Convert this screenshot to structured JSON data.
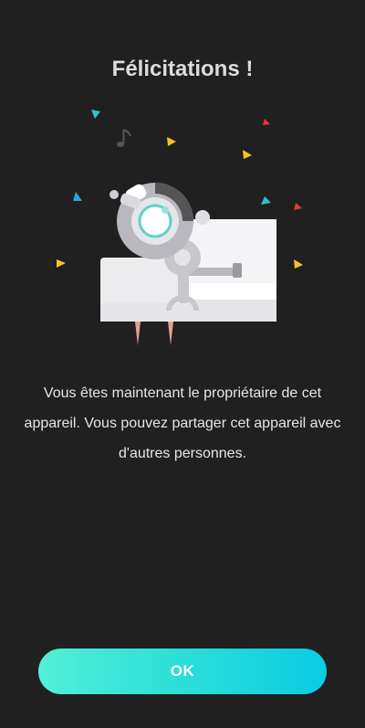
{
  "title": "Félicitations !",
  "message": "Vous êtes maintenant le propriétaire de cet appareil. Vous pouvez partager cet appareil avec d'autres personnes.",
  "ok_button": {
    "label": "OK"
  },
  "colors": {
    "background": "#202020",
    "button_gradient_start": "#52f0d7",
    "button_gradient_end": "#0ccbe2"
  }
}
